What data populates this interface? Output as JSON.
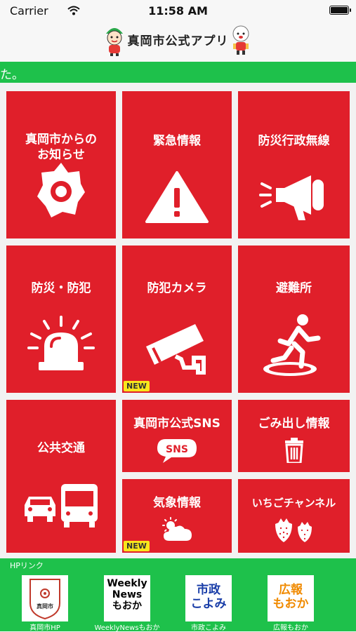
{
  "status_bar": {
    "carrier": "Carrier",
    "time": "11:58 AM"
  },
  "header": {
    "title": "真岡市公式アプリ"
  },
  "ticker": {
    "text": "た。"
  },
  "tiles": [
    {
      "label": "真岡市からの\nお知らせ",
      "icon": "badge-icon"
    },
    {
      "label": "緊急情報",
      "icon": "warning-icon"
    },
    {
      "label": "防災行政無線",
      "icon": "megaphone-icon"
    },
    {
      "label": "防災・防犯",
      "icon": "siren-icon"
    },
    {
      "label": "防犯カメラ",
      "icon": "security-camera-icon",
      "badge": "NEW"
    },
    {
      "label": "避難所",
      "icon": "running-person-icon"
    },
    {
      "label": "公共交通",
      "icon": "car-bus-icon"
    },
    {
      "label": "真岡市公式SNS",
      "icon": "sns-icon",
      "icon_text": "SNS"
    },
    {
      "label": "ごみ出し情報",
      "icon": "trash-can-icon"
    },
    {
      "label": "気象情報",
      "icon": "weather-icon",
      "badge": "NEW"
    },
    {
      "label": "いちごチャンネル",
      "icon": "strawberry-icon"
    }
  ],
  "hp_links": {
    "title": "HPリンク",
    "items": [
      {
        "caption": "真岡市HP",
        "thumb_text": "真岡市"
      },
      {
        "caption": "WeeklyNewsもおか",
        "thumb_lines": [
          "Weekly",
          "News",
          "もおか"
        ]
      },
      {
        "caption": "市政こよみ",
        "thumb_lines": [
          "市政",
          "こよみ"
        ]
      },
      {
        "caption": "広報もおか",
        "thumb_lines": [
          "広報",
          "もおか"
        ]
      }
    ]
  },
  "colors": {
    "tile_red": "#e01f2a",
    "green": "#1ec14b",
    "badge_yellow": "#f8e71c"
  }
}
